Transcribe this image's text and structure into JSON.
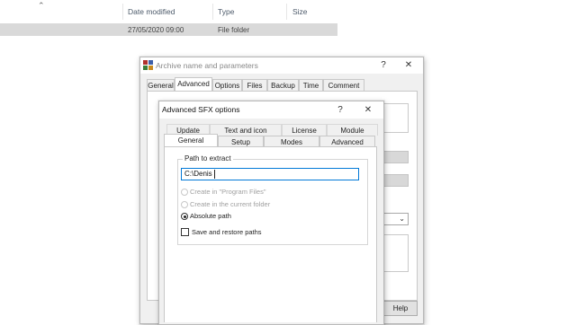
{
  "explorer": {
    "columns": {
      "date_modified": "Date modified",
      "type": "Type",
      "size": "Size"
    },
    "row": {
      "date": "27/05/2020 09:00",
      "type": "File folder"
    }
  },
  "outer_dialog": {
    "title": "Archive name and parameters",
    "help_symbol": "?",
    "close_symbol": "✕",
    "tabs": [
      {
        "label": "General"
      },
      {
        "label": "Advanced"
      },
      {
        "label": "Options"
      },
      {
        "label": "Files"
      },
      {
        "label": "Backup"
      },
      {
        "label": "Time"
      },
      {
        "label": "Comment"
      }
    ],
    "help_button": "Help"
  },
  "inner_dialog": {
    "title": "Advanced SFX options",
    "help_symbol": "?",
    "close_symbol": "✕",
    "tabs_row1": [
      {
        "label": "Update"
      },
      {
        "label": "Text and icon"
      },
      {
        "label": "License"
      },
      {
        "label": "Module"
      }
    ],
    "tabs_row2": [
      {
        "label": "General"
      },
      {
        "label": "Setup"
      },
      {
        "label": "Modes"
      },
      {
        "label": "Advanced"
      }
    ],
    "path_group_label": "Path to extract",
    "path_value": "C:\\Denis",
    "options": [
      {
        "label": "Create in \"Program Files\"",
        "enabled": false,
        "checked": false
      },
      {
        "label": "Create in the current folder",
        "enabled": false,
        "checked": false
      },
      {
        "label": "Absolute path",
        "enabled": true,
        "checked": true
      }
    ],
    "save_restore_label": "Save and restore paths",
    "save_restore_checked": false
  }
}
